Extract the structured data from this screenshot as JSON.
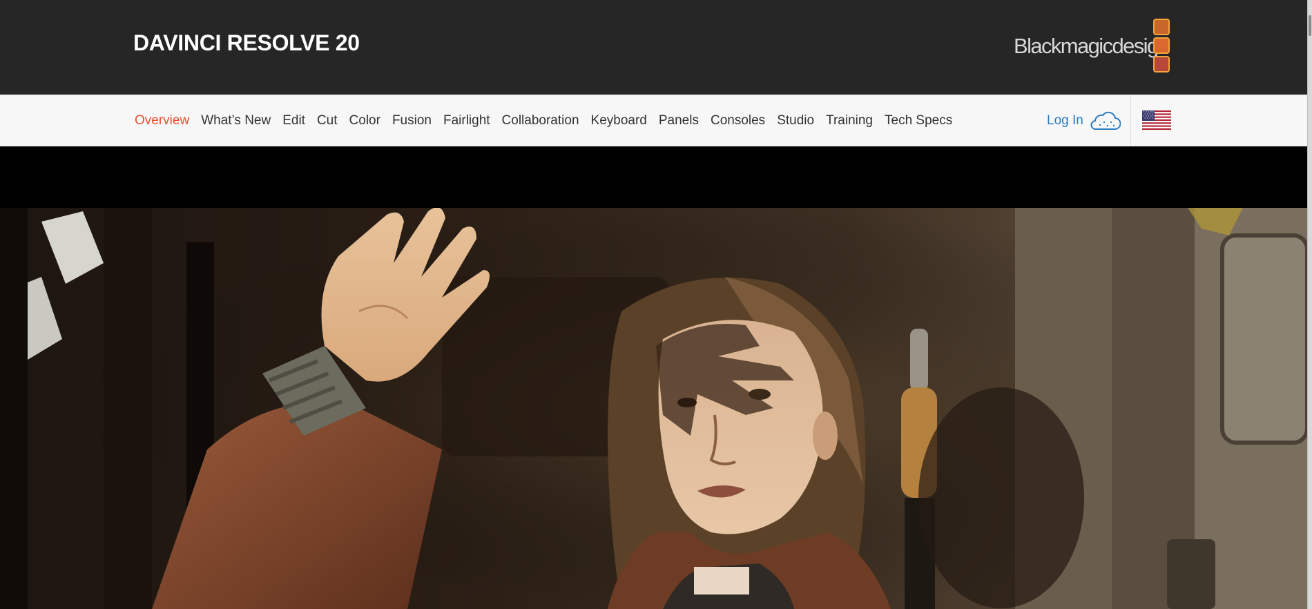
{
  "header": {
    "product_title": "DAVINCI RESOLVE 20",
    "brand_logo_text": "Blackmagicdesign",
    "brand_accent": "#f2a53a"
  },
  "nav": {
    "items": [
      {
        "label": "Overview",
        "active": true
      },
      {
        "label": "What’s New"
      },
      {
        "label": "Edit"
      },
      {
        "label": "Cut"
      },
      {
        "label": "Color"
      },
      {
        "label": "Fusion"
      },
      {
        "label": "Fairlight"
      },
      {
        "label": "Collaboration"
      },
      {
        "label": "Keyboard"
      },
      {
        "label": "Panels"
      },
      {
        "label": "Consoles"
      },
      {
        "label": "Studio"
      },
      {
        "label": "Training"
      },
      {
        "label": "Tech Specs"
      }
    ],
    "active_color": "#e8502e",
    "login_label": "Log In",
    "login_icon": "cloud-icon",
    "region_icon": "us-flag-icon"
  },
  "hero": {
    "image": "film-still-girl-raising-hand"
  }
}
